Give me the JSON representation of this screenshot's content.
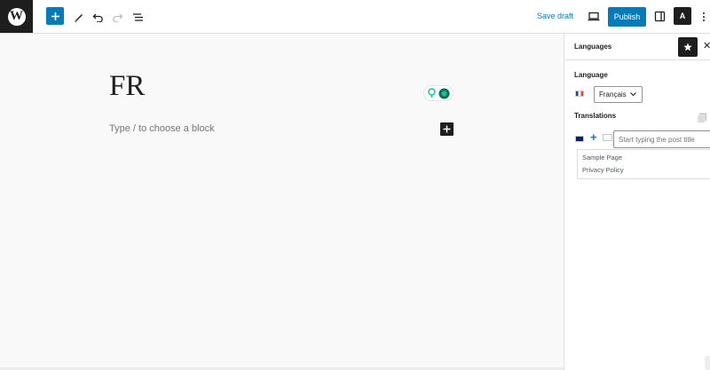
{
  "toolbar": {
    "logo_letter": "W",
    "save_draft": "Save draft",
    "publish": "Publish",
    "lang_toggle_glyph": "A"
  },
  "editor": {
    "title": "FR",
    "block_placeholder": "Type / to choose a block"
  },
  "sidebar": {
    "panel_title": "Languages",
    "language_label": "Language",
    "language_value": "Français",
    "translations_label": "Translations",
    "translation_input_placeholder": "Start typing the post title",
    "suggestions": [
      "Sample Page",
      "Privacy Policy"
    ]
  },
  "colors": {
    "accent": "#007cba",
    "dark": "#1e1e1e",
    "canvas_bg": "#f9f9f9",
    "grammar_green": "#15c39a",
    "grammar_dark": "#0f6e55"
  },
  "icons": [
    "wordpress-logo-icon",
    "plus-icon",
    "pen-icon",
    "undo-icon",
    "redo-icon",
    "list-view-icon",
    "desktop-preview-icon",
    "settings-sidebar-icon",
    "translate-icon",
    "more-options-icon",
    "star-icon",
    "close-icon",
    "flag-fr-icon",
    "flag-uk-icon",
    "copy-icon",
    "add-translation-icon",
    "edit-translation-icon",
    "chevron-down-icon",
    "grammar-assistant-icon"
  ]
}
